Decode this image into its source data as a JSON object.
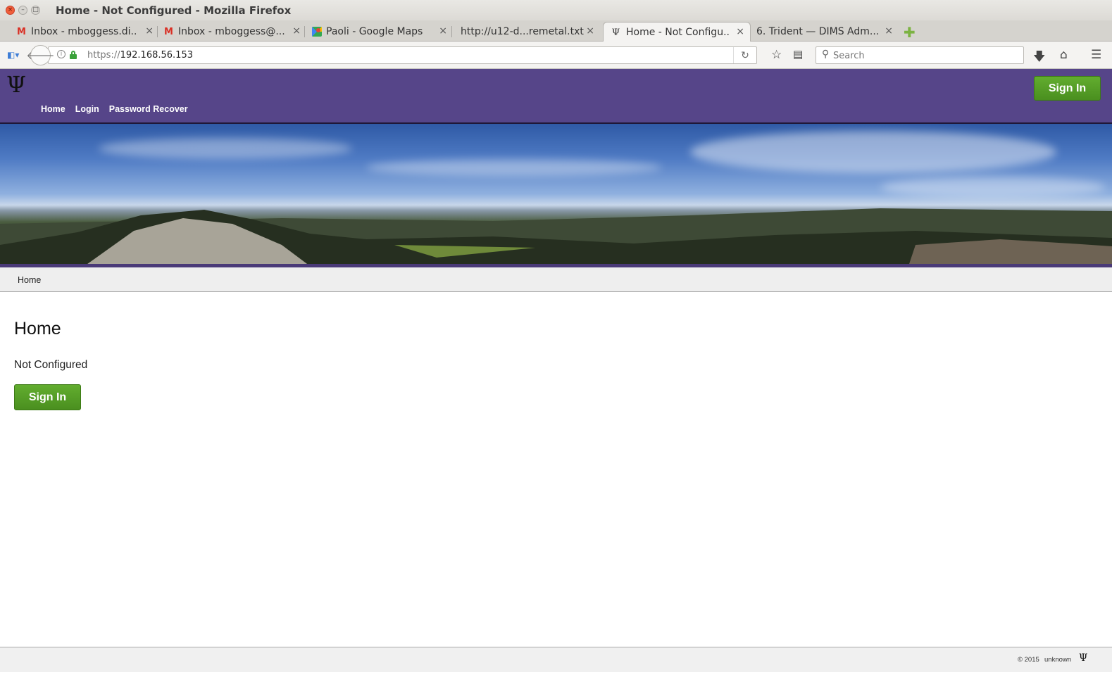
{
  "window": {
    "title": "Home - Not Configured - Mozilla Firefox"
  },
  "tabs": [
    {
      "label": "Inbox - mboggess.di...",
      "icon": "gmail-icon"
    },
    {
      "label": "Inbox - mboggess@...",
      "icon": "gmail-icon"
    },
    {
      "label": "Paoli - Google Maps",
      "icon": "google-maps-icon"
    },
    {
      "label": "http://u12-d...remetal.txt",
      "icon": ""
    },
    {
      "label": "Home - Not Configu...",
      "icon": "trident-icon",
      "active": true
    },
    {
      "label": "6. Trident — DIMS Adm...",
      "icon": ""
    }
  ],
  "toolbar": {
    "url_scheme": "https://",
    "url_host": "192.168.56.153",
    "search_placeholder": "Search"
  },
  "site": {
    "logo_glyph": "Ψ",
    "nav": [
      "Home",
      "Login",
      "Password Recover"
    ],
    "signin_label": "Sign In",
    "header_color": "#564589",
    "accent_green": "#58a028"
  },
  "breadcrumb": {
    "home": "Home"
  },
  "main": {
    "title": "Home",
    "status": "Not Configured",
    "signin_label": "Sign In"
  },
  "footer": {
    "copyright": "© 2015",
    "owner": "unknown",
    "logo_glyph": "Ψ"
  }
}
